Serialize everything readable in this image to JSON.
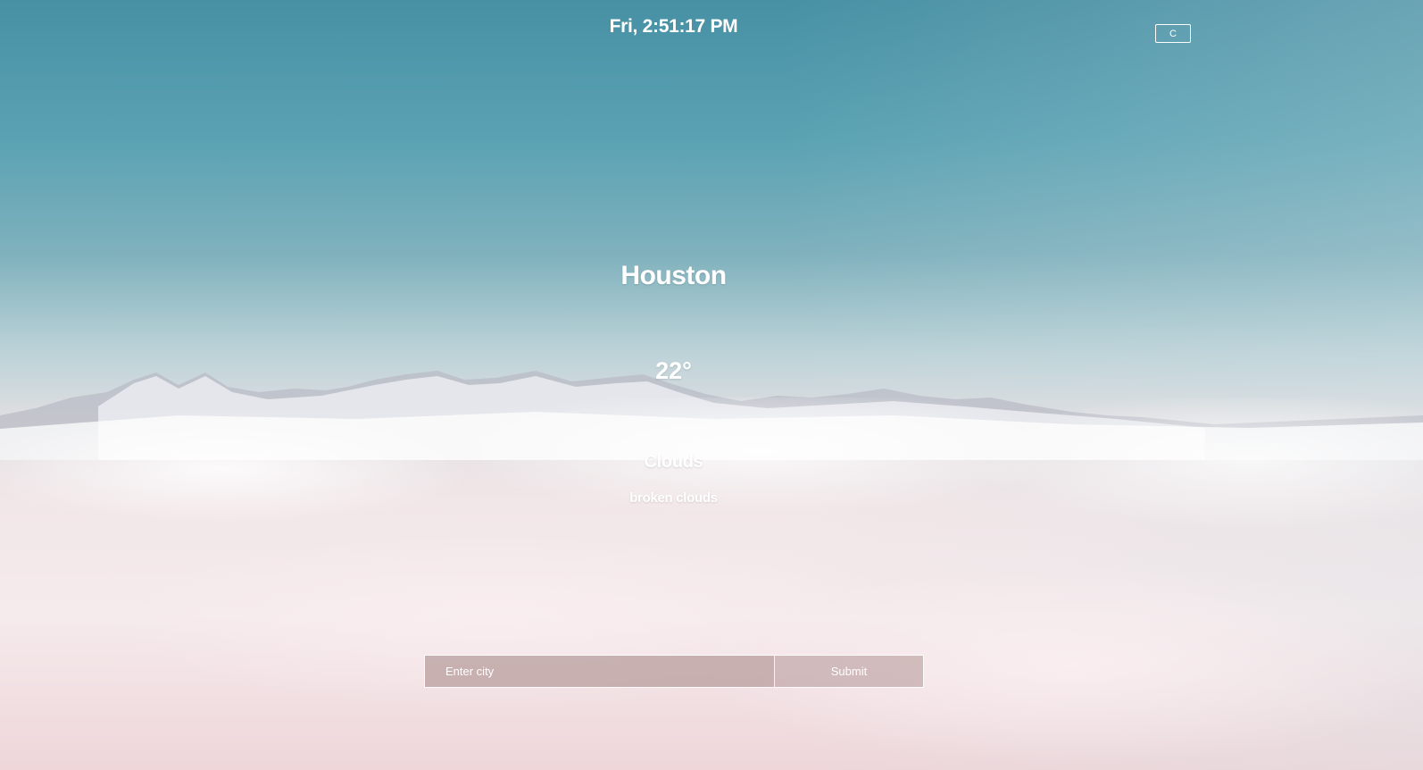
{
  "header": {
    "clock": "Fri, 2:51:17 PM",
    "unit_toggle_label": "C"
  },
  "weather": {
    "city": "Houston",
    "temperature": "22°",
    "condition": "Clouds",
    "description": "broken clouds"
  },
  "search": {
    "placeholder": "Enter city",
    "value": "",
    "submit_label": "Submit"
  },
  "colors": {
    "text": "#ffffff",
    "sky_top": "#4790a4",
    "cloud_pink": "#f5eaec",
    "input_bg": "#b29696"
  }
}
